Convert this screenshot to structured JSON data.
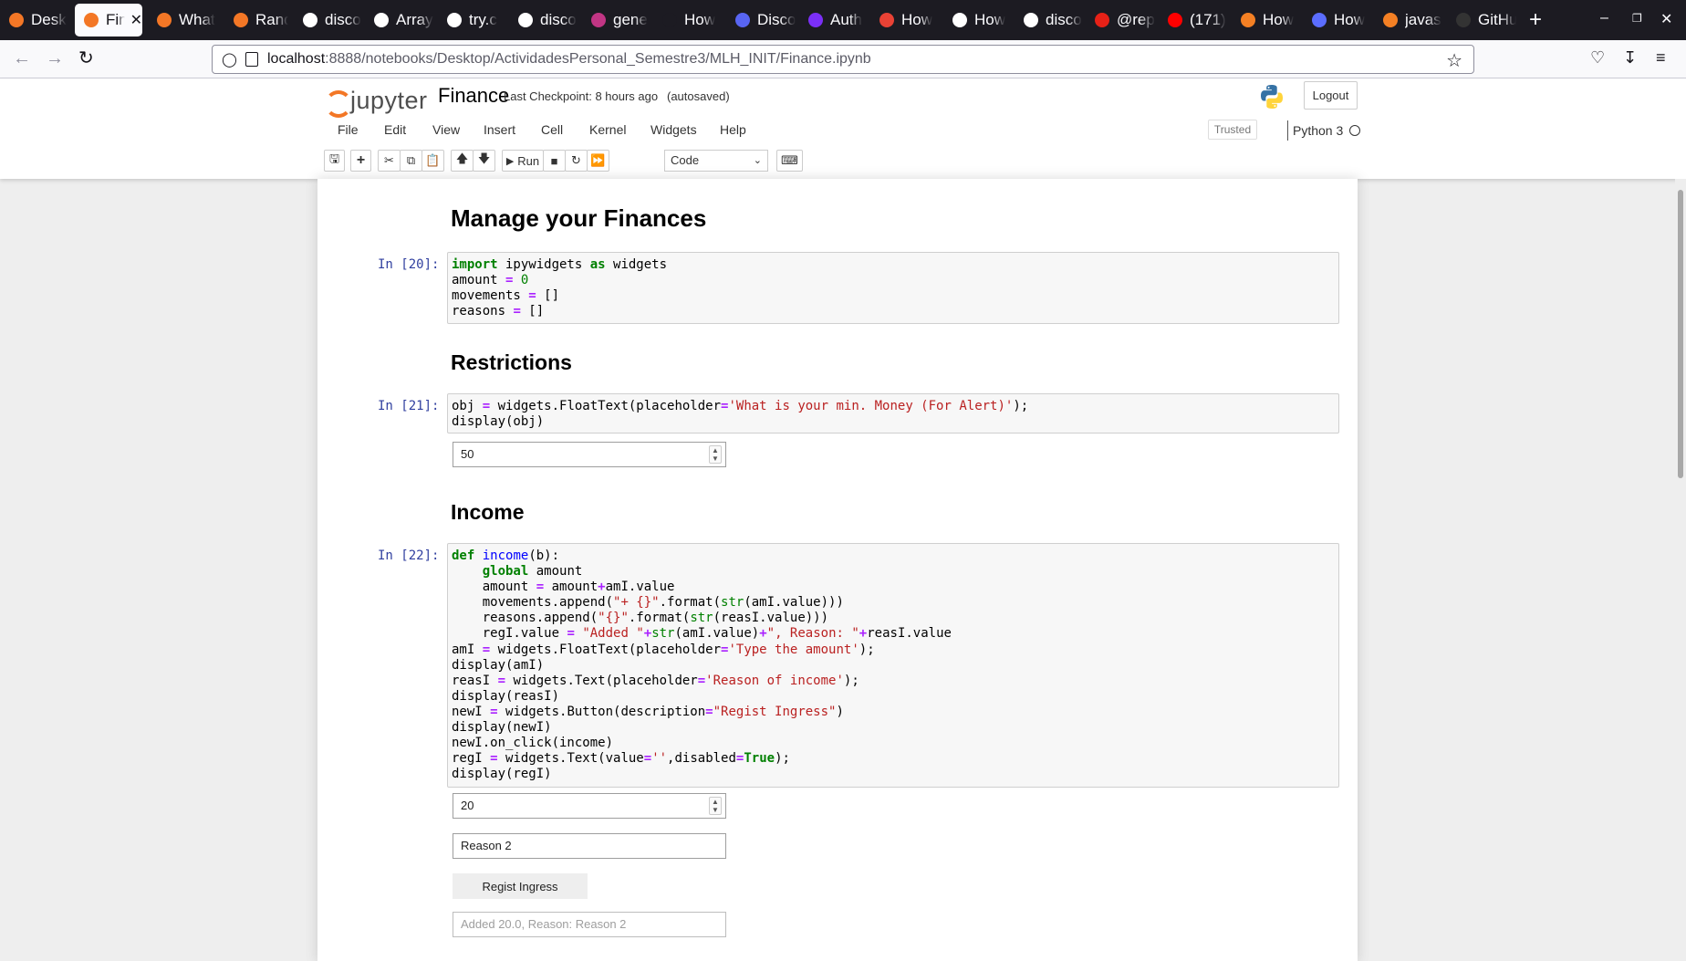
{
  "browser": {
    "tabs": [
      {
        "label": "Desk",
        "color": "#f37726",
        "active": false
      },
      {
        "label": "Fin",
        "color": "#f37726",
        "active": true
      },
      {
        "label": "What",
        "color": "#f37726",
        "active": false
      },
      {
        "label": "Rand",
        "color": "#f37726",
        "active": false
      },
      {
        "label": "disco",
        "color": "#ffffff",
        "active": false
      },
      {
        "label": "Array",
        "color": "#ffffff",
        "active": false
      },
      {
        "label": "try.c",
        "color": "#ffffff",
        "active": false
      },
      {
        "label": "disco",
        "color": "#ffffff",
        "active": false
      },
      {
        "label": "gene",
        "color": "#c13584",
        "active": false
      },
      {
        "label": "How",
        "color": "#1c1b22",
        "active": false
      },
      {
        "label": "Disco",
        "color": "#5865f2",
        "active": false
      },
      {
        "label": "Auth",
        "color": "#7b2ff7",
        "active": false
      },
      {
        "label": "How",
        "color": "#e94235",
        "active": false
      },
      {
        "label": "How",
        "color": "#ffffff",
        "active": false
      },
      {
        "label": "disco",
        "color": "#ffffff",
        "active": false
      },
      {
        "label": "@rep",
        "color": "#e62117",
        "active": false
      },
      {
        "label": "(171)",
        "color": "#ff0000",
        "active": false
      },
      {
        "label": "How",
        "color": "#f48024",
        "active": false
      },
      {
        "label": "How",
        "color": "#5b6dff",
        "active": false
      },
      {
        "label": "javas",
        "color": "#f48024",
        "active": false
      },
      {
        "label": "GitHu",
        "color": "#333333",
        "active": false
      }
    ],
    "new_tab": "+",
    "url_host": "localhost",
    "url_path": ":8888/notebooks/Desktop/ActividadesPersonal_Semestre3/MLH_INIT/Finance.ipynb"
  },
  "jupyter": {
    "logo_text": "jupyter",
    "notebook_name": "Finance",
    "checkpoint": "Last Checkpoint: 8 hours ago",
    "autosave": "(autosaved)",
    "logout": "Logout",
    "menu": [
      "File",
      "Edit",
      "View",
      "Insert",
      "Cell",
      "Kernel",
      "Widgets",
      "Help"
    ],
    "trusted": "Trusted",
    "kernel": "Python 3",
    "run_label": "Run",
    "cell_type": "Code"
  },
  "notebook": {
    "heading1": "Manage your Finances",
    "cell1_prompt": "In [20]:",
    "heading2": "Restrictions",
    "cell2_prompt": "In [21]:",
    "min_money_value": "50",
    "heading3": "Income",
    "cell3_prompt": "In [22]:",
    "amount_value": "20",
    "reason_value": "Reason 2",
    "regist_button": "Regist Ingress",
    "reg_output": "Added 20.0, Reason: Reason 2"
  }
}
